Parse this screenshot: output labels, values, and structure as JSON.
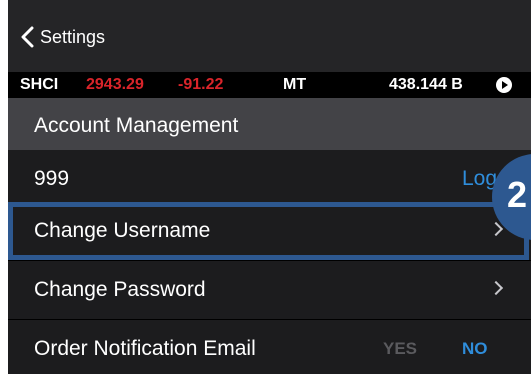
{
  "nav": {
    "back_label": "Settings"
  },
  "ticker": {
    "index": "SHCI",
    "price": "2943.29",
    "change": "-91.22",
    "label": "MT",
    "amount": "438.144 B"
  },
  "section": {
    "title": "Account Management"
  },
  "rows": {
    "account_number": "999",
    "logout_label": "Logout",
    "change_username": "Change Username",
    "change_password": "Change Password",
    "order_email": "Order Notification Email",
    "yes_label": "YES",
    "no_label": "NO"
  },
  "annotation": {
    "step": "2"
  },
  "colors": {
    "accent": "#2f8ddb",
    "negative": "#d9242a",
    "highlight": "#2d5890"
  }
}
